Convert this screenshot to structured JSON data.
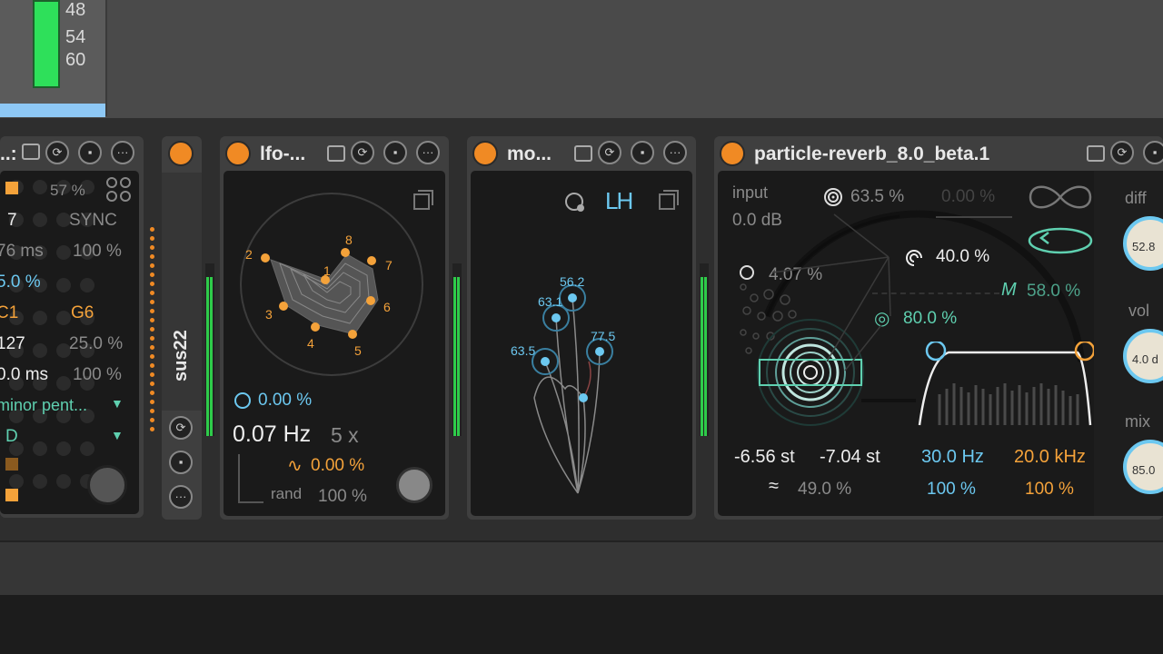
{
  "top": {
    "meter_scale": [
      "48",
      "54",
      "60"
    ]
  },
  "device1": {
    "title": "..:",
    "rows": [
      {
        "left": "",
        "right": "57 %"
      },
      {
        "left": "7",
        "right": "SYNC"
      },
      {
        "left": "76 ms",
        "right": "100 %"
      },
      {
        "left": "5.0 %",
        "right": ""
      },
      {
        "left": "C1",
        "right": "G6"
      },
      {
        "left": "127",
        "right": "25.0 %"
      },
      {
        "left": "0.0 ms",
        "right": "100 %"
      }
    ],
    "scale_label": "minor pent...",
    "key_label": "D"
  },
  "device2": {
    "title": "sus22"
  },
  "device3": {
    "title": "lfo-...",
    "points": [
      "1",
      "2",
      "3",
      "4",
      "5",
      "6",
      "7",
      "8"
    ],
    "phase": "0.00 %",
    "rate": "0.07 Hz",
    "multiplier": "5 x",
    "wave_amount": "0.00 %",
    "rand_label": "rand",
    "rand_value": "100 %"
  },
  "device4": {
    "title": "mo...",
    "mode_label": "LH",
    "node_labels": [
      "56.2",
      "63.1",
      "63.5",
      "77.5"
    ]
  },
  "device5": {
    "title": "particle-reverb_8.0_beta.1",
    "input_label": "input",
    "input_value": "0.0 dB",
    "density": "63.5 %",
    "feedback_dim": "0.00 %",
    "spread": "4.07 %",
    "size": "40.0 %",
    "mod": "58.0 %",
    "shimmer": "80.0 %",
    "pitch_a": "-6.56 st",
    "pitch_b": "-7.04 st",
    "texture": "49.0 %",
    "lowcut": "30.0 Hz",
    "highcut": "20.0 kHz",
    "lowcut_amt": "100 %",
    "highcut_amt": "100 %",
    "diff_label": "diff",
    "diff_value": "52.8",
    "vol_label": "vol",
    "vol_value": "4.0 d",
    "mix_label": "mix",
    "mix_value": "85.0"
  },
  "colors": {
    "accent": "#f08a24",
    "blue": "#6cc8f0",
    "teal": "#5fd0b0",
    "meter": "#2ee05a"
  }
}
